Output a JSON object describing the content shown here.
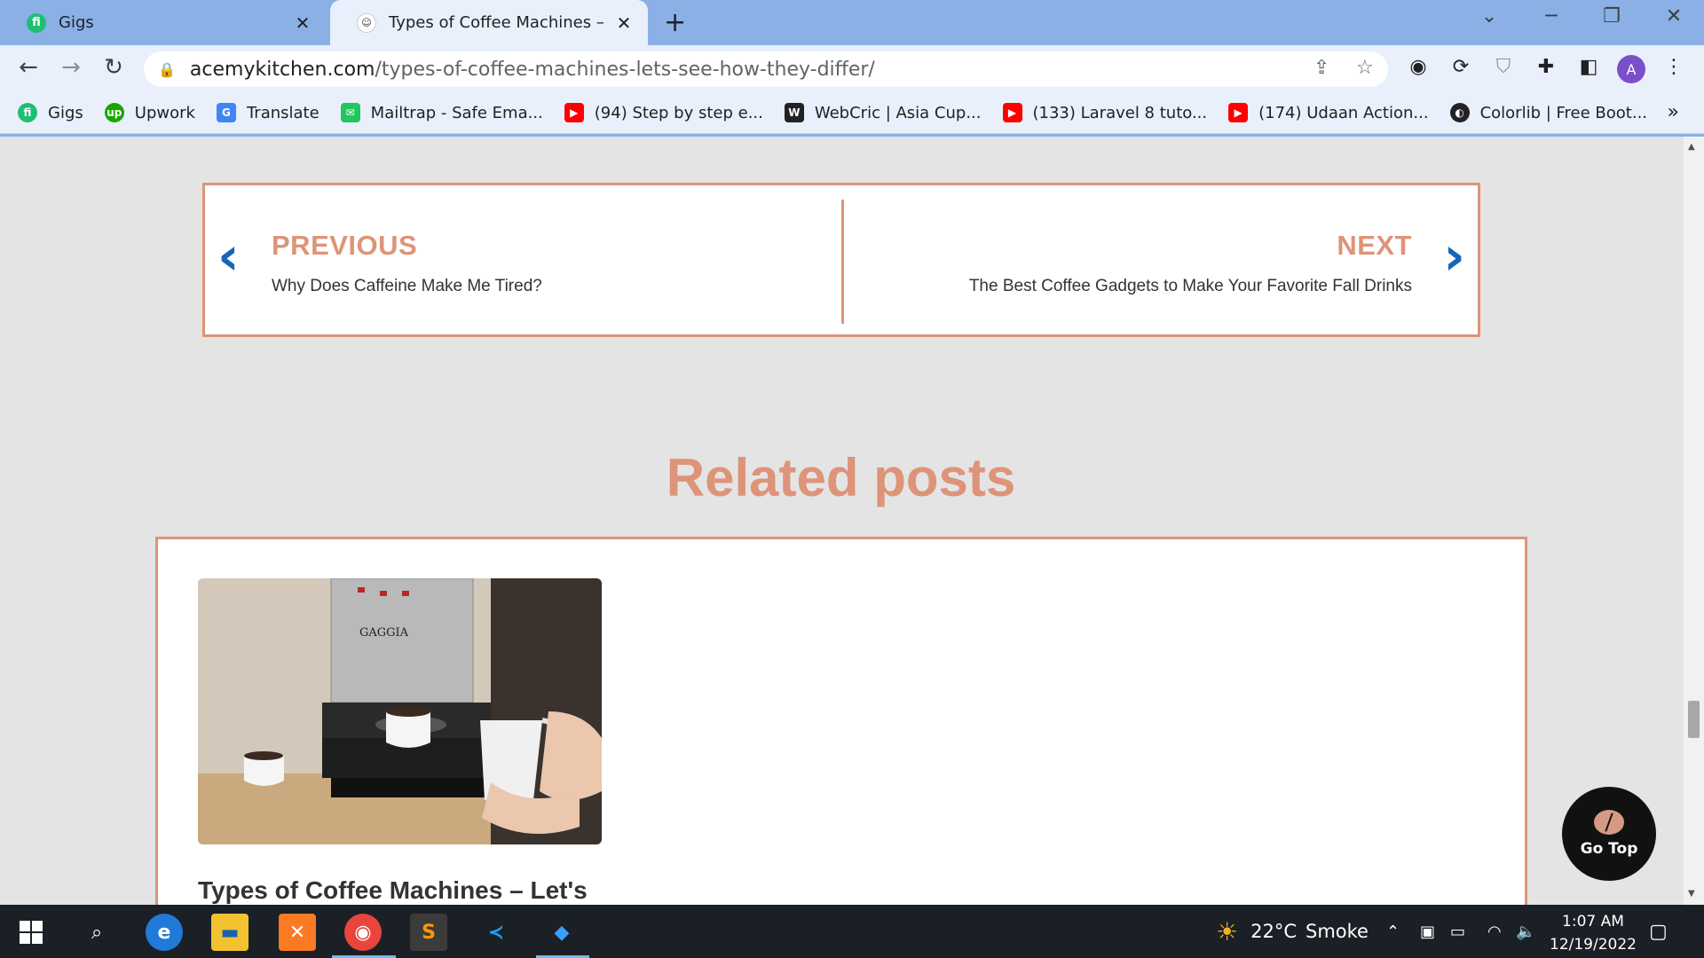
{
  "browser": {
    "tabs": [
      {
        "title": "Gigs",
        "favicon": "fiverr-icon",
        "active": false
      },
      {
        "title": "Types of Coffee Machines – Let's",
        "favicon": "site-icon",
        "active": true
      }
    ],
    "address": {
      "host": "acemykitchen.com",
      "path": "/types-of-coffee-machines-lets-see-how-they-differ/"
    },
    "profile_initial": "A",
    "bookmarks": [
      {
        "label": "Gigs",
        "icon": "fiverr-icon",
        "color": "#1dbf73"
      },
      {
        "label": "Upwork",
        "icon": "upwork-icon",
        "color": "#14a800"
      },
      {
        "label": "Translate",
        "icon": "translate-icon",
        "color": "#4285f4"
      },
      {
        "label": "Mailtrap - Safe Ema...",
        "icon": "mailtrap-icon",
        "color": "#22c55e"
      },
      {
        "label": "(94) Step by step e...",
        "icon": "youtube-icon",
        "color": "#ff0000"
      },
      {
        "label": "WebCric | Asia Cup...",
        "icon": "webcric-icon",
        "color": "#222222"
      },
      {
        "label": "(133) Laravel 8 tuto...",
        "icon": "youtube-icon",
        "color": "#ff0000"
      },
      {
        "label": "(174) Udaan Action...",
        "icon": "youtube-icon",
        "color": "#ff0000"
      },
      {
        "label": "Colorlib | Free Boot...",
        "icon": "colorlib-icon",
        "color": "#222222"
      }
    ],
    "bookmarks_more": "»"
  },
  "page": {
    "post_nav": {
      "previous_label": "PREVIOUS",
      "previous_title": "Why Does Caffeine Make Me Tired?",
      "next_label": "NEXT",
      "next_title": "The Best Coffee Gadgets to Make Your Favorite Fall Drinks"
    },
    "related_heading": "Related posts",
    "related_card": {
      "title": "Types of Coffee Machines – Let's",
      "image_brand_text": "GAGGIA"
    },
    "go_top_label": "Go Top",
    "accent_color": "#dd9478",
    "chevron_color": "#1667b8"
  },
  "taskbar": {
    "weather_temp": "22°C",
    "weather_desc": "Smoke",
    "time": "1:07 AM",
    "date": "12/19/2022"
  }
}
